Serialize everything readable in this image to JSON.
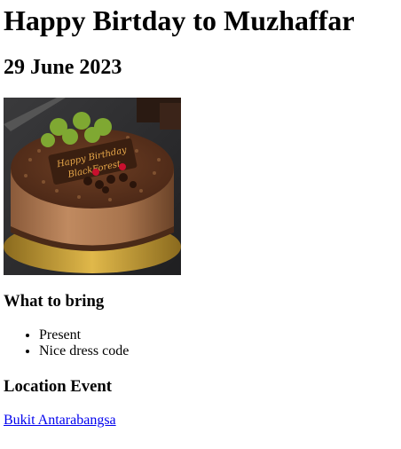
{
  "page": {
    "title": "Happy Birtday to Muzhaffar",
    "date": "29 June 2023"
  },
  "image": {
    "description_icon": "birthday-cake-image",
    "topper_text": "Happy Birthday BlackForest"
  },
  "bring": {
    "heading": "What to bring",
    "items": [
      "Present",
      "Nice dress code"
    ]
  },
  "location": {
    "heading": "Location Event",
    "link_text": "Bukit Antarabangsa"
  },
  "colors": {
    "link": "#0000ee",
    "text": "#000000"
  }
}
